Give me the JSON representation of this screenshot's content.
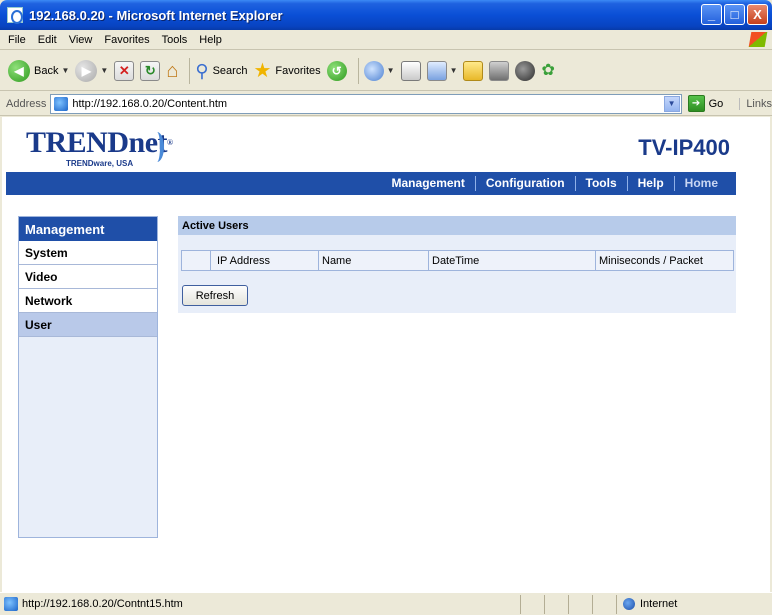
{
  "window": {
    "title": "192.168.0.20 - Microsoft Internet Explorer",
    "controls": [
      "_",
      "□",
      "X"
    ]
  },
  "menu": [
    "File",
    "Edit",
    "View",
    "Favorites",
    "Tools",
    "Help"
  ],
  "toolbar": {
    "back_label": "Back",
    "search_label": "Search",
    "favorites_label": "Favorites"
  },
  "address": {
    "label": "Address",
    "url": "http://192.168.0.20/Content.htm",
    "go_label": "Go",
    "links_label": "Links"
  },
  "page": {
    "brand": "TRENDnet",
    "brand_mark": "®",
    "brand_tagline": "TRENDware, USA",
    "model": "TV-IP400",
    "nav": [
      "Management",
      "Configuration",
      "Tools",
      "Help",
      "Home"
    ],
    "sidebar": {
      "heading": "Management",
      "items": [
        "System",
        "Video",
        "Network",
        "User"
      ],
      "selected": "User"
    },
    "panel": {
      "title": "Active Users",
      "columns": [
        "",
        "IP Address",
        "Name",
        "DateTime",
        "Miniseconds / Packet"
      ],
      "refresh_label": "Refresh"
    }
  },
  "status": {
    "text": "http://192.168.0.20/Contnt15.htm",
    "zone": "Internet"
  },
  "colors": {
    "nav_blue": "#1f4fa8",
    "brand_blue": "#1a3a8a",
    "panel_bg": "#e8eef9",
    "panel_head": "#b7cbea",
    "selected_item": "#b9c9e9"
  }
}
